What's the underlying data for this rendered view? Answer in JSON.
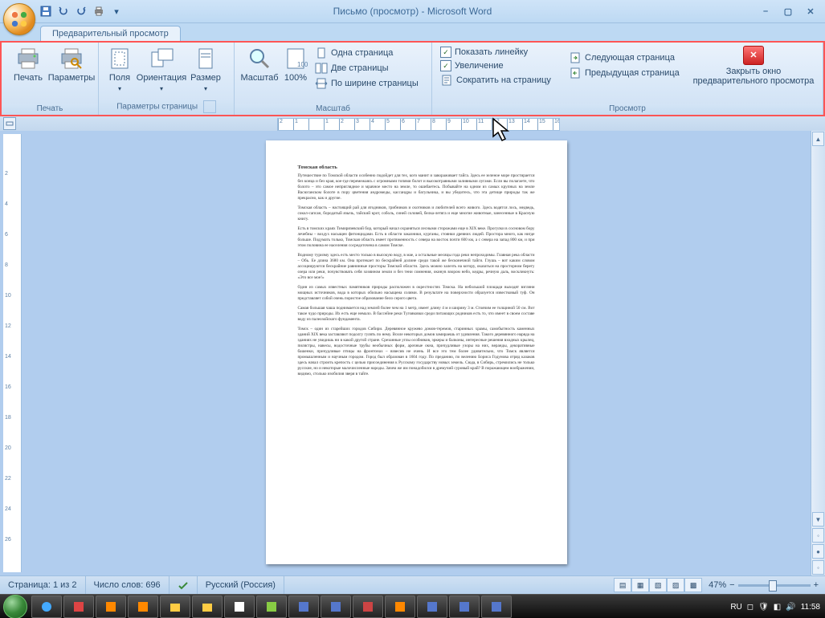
{
  "window": {
    "title": "Письмо (просмотр) - Microsoft Word"
  },
  "tab": {
    "label": "Предварительный просмотр"
  },
  "ribbon": {
    "print_group": {
      "label": "Печать",
      "print": "Печать",
      "options": "Параметры"
    },
    "page_setup": {
      "label": "Параметры страницы",
      "margins": "Поля",
      "orientation": "Ориентация",
      "size": "Размер"
    },
    "zoom_group": {
      "label": "Масштаб",
      "zoom": "Масштаб",
      "hundred": "100%",
      "one_page": "Одна страница",
      "two_pages": "Две страницы",
      "page_width": "По ширине страницы"
    },
    "preview_group": {
      "label": "Просмотр",
      "show_ruler": "Показать линейку",
      "magnifier": "Увеличение",
      "shrink": "Сократить на страницу",
      "next_page": "Следующая страница",
      "prev_page": "Предыдущая страница",
      "close": "Закрыть окно предварительного просмотра"
    }
  },
  "ruler_marks": [
    "2",
    "1",
    "",
    "1",
    "2",
    "3",
    "4",
    "5",
    "6",
    "7",
    "8",
    "9",
    "10",
    "11",
    "12",
    "13",
    "14",
    "15",
    "16"
  ],
  "vruler_marks": [
    "",
    "2",
    "4",
    "6",
    "8",
    "10",
    "12",
    "14",
    "16",
    "18",
    "20",
    "22",
    "24",
    "26"
  ],
  "document": {
    "heading": "Томская область",
    "p1": "Путешествие по Томской области особенно подойдет для тех, кого манит и завораживает тайга. Здесь ее зеленое море простирается без конца и без края, кое-где перемежаясь с огромными топями болот и высокотравными заливными лугами. Если вы полагаете, что болото – это самое неприглядное и мрачное место на земле, то ошибаетесь. Побывайте на одном из самых крупных на земле Васюганском болоте в пору цветения андромеды, кассандры и багульника, и вы убедитесь, что эта детище природы так же прекрасно, как и другие.",
    "p2": "Томская область – настоящий рай для ягодников, грибников и охотников и любителей всего живого. Здесь водятся лось, медведь, сокол-сапсан, бородатый язычь, тайский крот, соболь, синей соловей, белка-летяга и еще многие животные, занесенные в Красную книгу.",
    "p3": "Есть в томских краях Тимирязевский бор, который начал охраняться лесными сторожами еще в XIX веке. Прогулки в сосновом бору лечебны – воздух насыщен фитонцидами. Есть в области заказники, курганы, стоянки древних людей. Простора много, как нигде больше. Подумать только, Томская область имеет протяженность с севера на восток почти 600 км, а с севера на запад 800 км, и при этом половина ее населения сосредоточена в самом Томске.",
    "p4": "Водному туризму здесь есть место только в высокую воду, в мае, а остальные месяцы года реки непроходимы. Главная река области – Обь. Ее длина 3680 км. Она протекает по бескрайней долине среди такой же бесконечной тайги. Глушь – вот каким словом ассоциируются бескрайние равнинные просторы Томской области. Здесь можно залезть на котору, оказаться на просторном берегу озера или реки, почувствовать себя хозяином земли и без тени сомнения, окинув взором небо, кедры, речную даль, воскликнуть: «Это все мое!»",
    "p5": "Один из самых известных памятников природы расположен в окрестностях Томска. На небольшой площади выходят взгляни мощных источников, вода в которых обильно насыщена солями. В результате на поверхности образуется известковый туф. Он представляет собой очень пористое образование бело серого цвета.",
    "p6": "Самая большая чаша поднимается над землей более чем на 1 метр, имеет длину 4 м и ширину 3 м. Стоячим ее толщиной 50 см. Вот такое чудо природы. Их есть еще немало. В бассейне реки Тугояковки среди питающих родников есть то, что имеет в своем составе воду из палеозойского фундамента.",
    "p7": "Томск – один из старейших городов Сибири. Деревянное кружево домов-теремов, старинных храмы, самобытность каменных зданий XIX века заставляют подолгу гулять по нему. Возле некоторых домов замираешь от удивления. Такого деревянного наряда на зданиях не увидишь ни в какой другой стране. Срезанные углы особняков, эркеры и балконы, интересные решения входных крылец, пилястры, навесы, водосточные трубы необычных форм, арочные окна, причудливые узоры на них, веранды, декоративные башенки, причудливые птицы на фронтонах – взвесив не очень. И все это тем более удивительно, что Томск является промышленным и научным городом. Город был образован в 1604 году. По преданию, по велению Бориса Годунова отряд казаков здесь начал строить крепость с целью присоединения к Русскому государству новых земель. Сюда, в Сибирь, стремились не только русские, но и некоторые малочисленные народы. Зачем же им понадобился в дремучий суровый край? В поражающем воображении, видимо, столько изобилия зверя в тайге."
  },
  "status": {
    "page": "Страница: 1 из 2",
    "words": "Число слов: 696",
    "language": "Русский (Россия)",
    "zoom": "47%"
  },
  "tray": {
    "lang": "RU",
    "time": "11:58"
  }
}
